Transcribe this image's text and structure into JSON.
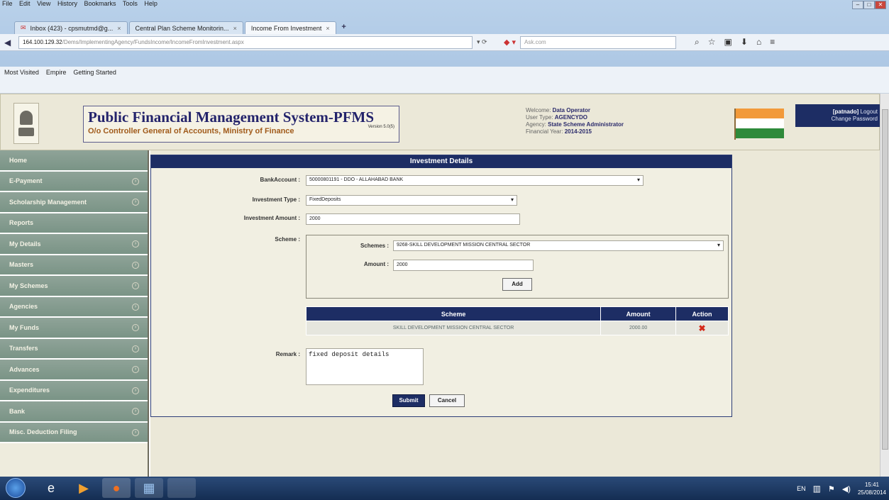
{
  "browser": {
    "menu": [
      "File",
      "Edit",
      "View",
      "History",
      "Bookmarks",
      "Tools",
      "Help"
    ],
    "tabs": [
      {
        "label": "Inbox (423) - cpsmutmd@g..."
      },
      {
        "label": "Central Plan Scheme Monitorin..."
      },
      {
        "label": "Income From Investment"
      }
    ],
    "url_host": "164.100.129.32",
    "url_path": "/Dems/ImplementingAgency/FundsIncome/IncomeFromInvestment.aspx",
    "search_placeholder": "Ask.com",
    "bookmarks": [
      "Most Visited",
      "Empire",
      "Getting Started"
    ]
  },
  "header": {
    "title": "Public Financial Management System-PFMS",
    "subtitle": "O/o Controller General of Accounts, Ministry of Finance",
    "version": "Version 5.0(5)",
    "welcome_label": "Welcome:",
    "welcome_value": "Data Operator",
    "usertype_label": "User Type:",
    "usertype_value": "AGENCYDO",
    "agency_label": "Agency:",
    "agency_value": "State Scheme Administrator",
    "fy_label": "Financial Year:",
    "fy_value": "2014-2015",
    "username": "[patnado]",
    "logout": "Logout",
    "change_password": "Change Password"
  },
  "sidebar": {
    "items": [
      {
        "label": "Home",
        "chev": false
      },
      {
        "label": "E-Payment",
        "chev": true
      },
      {
        "label": "Scholarship Management",
        "chev": true
      },
      {
        "label": "Reports",
        "chev": false
      },
      {
        "label": "My Details",
        "chev": true
      },
      {
        "label": "Masters",
        "chev": true
      },
      {
        "label": "My Schemes",
        "chev": true
      },
      {
        "label": "Agencies",
        "chev": true
      },
      {
        "label": "My Funds",
        "chev": true
      },
      {
        "label": "Transfers",
        "chev": true
      },
      {
        "label": "Advances",
        "chev": true
      },
      {
        "label": "Expenditures",
        "chev": true
      },
      {
        "label": "Bank",
        "chev": true
      },
      {
        "label": "Misc. Deduction Filing",
        "chev": true
      }
    ]
  },
  "form": {
    "panel_title": "Investment Details",
    "bank_label": "BankAccount :",
    "bank_value": "50000801191 - DDO - ALLAHABAD BANK",
    "type_label": "Investment Type :",
    "type_value": "FixedDeposits",
    "amount_label": "Investment Amount :",
    "amount_value": "2000",
    "scheme_label": "Scheme :",
    "schemes_label": "Schemes :",
    "schemes_value": "9268-SKILL DEVELOPMENT MISSION CENTRAL SECTOR",
    "scheme_amount_label": "Amount :",
    "scheme_amount_value": "2000",
    "add_label": "Add",
    "table_headers": [
      "Scheme",
      "Amount",
      "Action"
    ],
    "table_rows": [
      {
        "scheme": "SKILL DEVELOPMENT MISSION CENTRAL SECTOR",
        "amount": "2000.00",
        "action": "✖"
      }
    ],
    "remark_label": "Remark :",
    "remark_value": "fixed deposit details",
    "submit_label": "Submit",
    "cancel_label": "Cancel"
  },
  "taskbar": {
    "lang": "EN",
    "time": "15:41",
    "date": "25/08/2014"
  },
  "colors": {
    "navy": "#1d2d64",
    "sidebar": "#8fa398",
    "page_bg": "#ebe8d8",
    "delete_red": "#d52a1a"
  }
}
